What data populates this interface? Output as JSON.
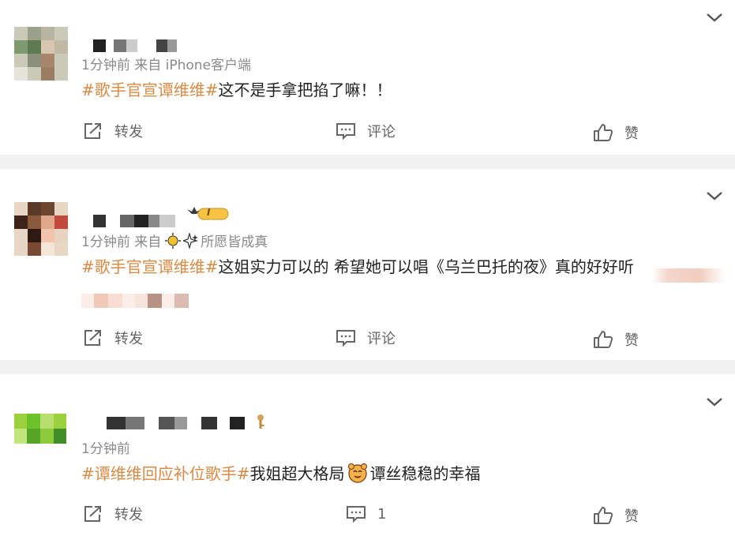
{
  "posts": [
    {
      "meta": "1分钟前  来自 iPhone客户端",
      "topic": "#歌手官宣谭维维#",
      "text": "这不是手拿把掐了嘛！！",
      "actions": {
        "repost": "转发",
        "comment": "评论",
        "like": "赞"
      }
    },
    {
      "meta_time": "1分钟前  来自",
      "meta_source": "所愿皆成真",
      "badge": "I",
      "topic": "#歌手官宣谭维维#",
      "text": "这姐实力可以的 希望她可以唱《乌兰巴托的夜》真的好好听",
      "actions": {
        "repost": "转发",
        "comment": "评论",
        "like": "赞"
      }
    },
    {
      "meta": "1分钟前",
      "topic": "#谭维维回应补位歌手#",
      "text_before": "我姐超大格局",
      "text_after": "谭丝稳稳的幸福",
      "actions": {
        "repost": "转发",
        "comment": "1",
        "like": "赞"
      }
    }
  ],
  "colors": {
    "topic": "#d98a45",
    "meta": "#8a8a8a",
    "separator": "#f1f1f1"
  }
}
